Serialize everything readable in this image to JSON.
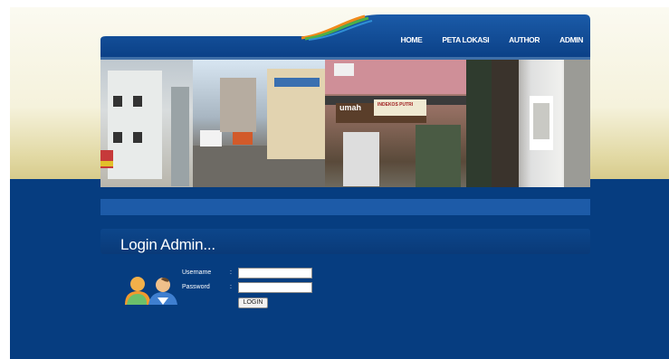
{
  "nav": {
    "items": [
      {
        "label": "HOME"
      },
      {
        "label": "PETA LOKASI"
      },
      {
        "label": "AUTHOR"
      },
      {
        "label": "ADMIN"
      }
    ]
  },
  "banner": {
    "sign_text": "umah",
    "sign_small_text": "INDEKOS PUTRI"
  },
  "login": {
    "title": "Login Admin...",
    "username_label": "Username",
    "password_label": "Password",
    "colon": ":",
    "username_value": "",
    "password_value": "",
    "button_label": "LOGIN"
  },
  "colors": {
    "page_blue": "#063d80",
    "nav_blue": "#1b5ba8",
    "accent_orange": "#f08a1a",
    "accent_green": "#4ab04a"
  }
}
